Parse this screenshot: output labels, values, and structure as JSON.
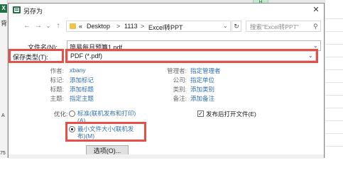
{
  "excel": {
    "badge": "X",
    "column_letter": "H",
    "row_numbers": [
      "8",
      "9",
      "10",
      "11",
      "12",
      "13",
      "14",
      "15",
      "16",
      "17",
      "18",
      "19",
      "20"
    ],
    "side_chars": [
      "背",
      "A",
      "75"
    ]
  },
  "dialog": {
    "title": "另存为",
    "close": "✕"
  },
  "nav": {
    "back": "←",
    "forward": "→",
    "dropdown": "⌄",
    "up": "↑",
    "breadcrumb_prefix": "«",
    "breadcrumbs": [
      "Desktop",
      "1113",
      "Excel转PPT"
    ],
    "sep": ">",
    "refresh": "↻",
    "search_placeholder": "搜索\"Excel转PPT\"",
    "search_icon": "⚲"
  },
  "form": {
    "filename_label": "文件名(N):",
    "filename_value": "简易每月预算1.pdf",
    "filetype_label": "保存类型(T):",
    "filetype_value": "PDF (*.pdf)"
  },
  "meta_left": [
    {
      "label": "作者:",
      "value": "xbany"
    },
    {
      "label": "标记:",
      "value": "添加标记"
    },
    {
      "label": "标题:",
      "value": "添加标题"
    },
    {
      "label": "主题:",
      "value": "指定主题"
    }
  ],
  "meta_right": [
    {
      "label": "管理者:",
      "value": "指定管理者"
    },
    {
      "label": "公司:",
      "value": "指定单位"
    },
    {
      "label": "类别:",
      "value": "添加类别"
    },
    {
      "label": "备注:",
      "value": "添加备注"
    }
  ],
  "optimize": {
    "label": "优化:",
    "option1_line1": "标准(联机发布和打印)",
    "option1_line2": "(A)",
    "option2_line1": "最小文件大小(联机发",
    "option2_line2": "布)(M)",
    "selected": "option2"
  },
  "open_after": {
    "label": "发布后打开文件(E)",
    "checked": true
  },
  "options_button": "选项(O)...",
  "colors": {
    "highlight": "#e6504a",
    "link": "#2f6fb5",
    "excel_green": "#1e7145"
  }
}
